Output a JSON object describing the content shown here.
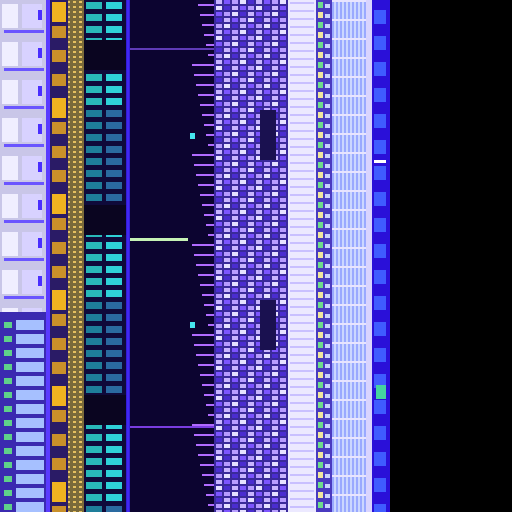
{
  "image": {
    "subject": "chip-die-micrograph",
    "palette": {
      "background": "#000000",
      "dark_substrate": "#12073a",
      "metal_blue": "#2a18c8",
      "bright_metal": "#e8e4ff",
      "lilac": "#b8a6ff",
      "pale_blue": "#8fb0ff",
      "gold": "#e5a021",
      "cyan": "#2fd1d8",
      "green": "#6fdc8c",
      "accent_violet": "#7b3dff"
    }
  }
}
